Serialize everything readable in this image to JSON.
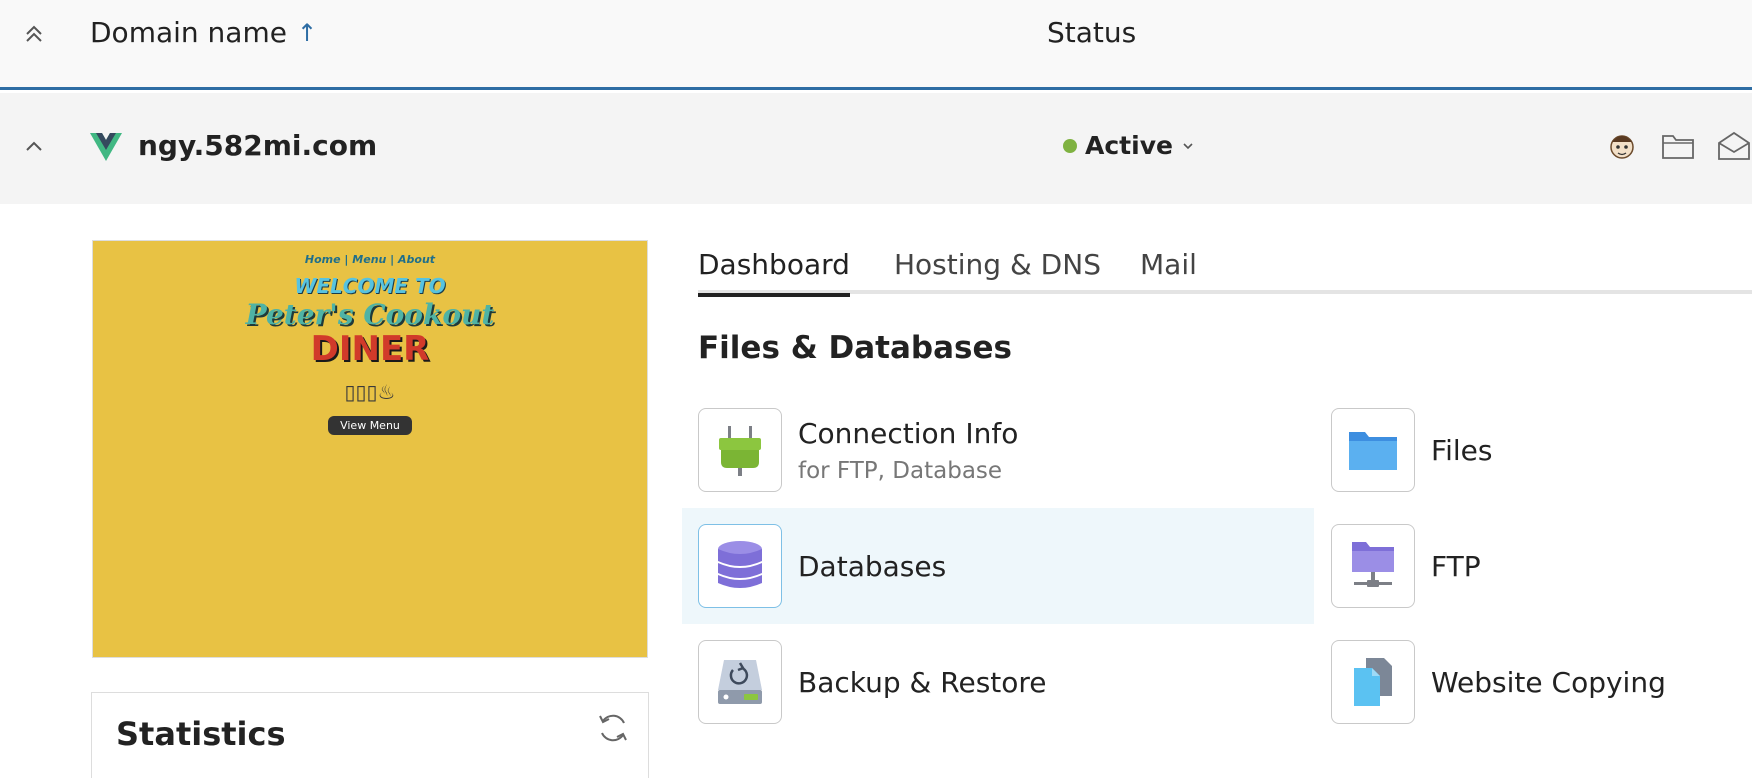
{
  "header": {
    "domain_col": "Domain name",
    "sort_arrow": "↑",
    "status_col": "Status"
  },
  "domain": {
    "name": "ngy.582mi.com",
    "status": "Active",
    "status_color": "#7fb241",
    "icons": [
      "site-avatar-icon",
      "folder-icon",
      "mail-icon"
    ]
  },
  "preview": {
    "nav": "Home | Menu | About",
    "welcome": "WELCOME TO",
    "name": "Peter's Cookout",
    "diner": "DINER",
    "icons": "▯▯▯♨",
    "button": "View Menu"
  },
  "statistics": {
    "title": "Statistics"
  },
  "tabs": [
    {
      "label": "Dashboard",
      "active": true
    },
    {
      "label": "Hosting & DNS",
      "active": false
    },
    {
      "label": "Mail",
      "active": false
    }
  ],
  "section": {
    "title": "Files & Databases"
  },
  "tools": {
    "connection": {
      "label": "Connection Info",
      "sub": "for FTP, Database"
    },
    "files": {
      "label": "Files"
    },
    "databases": {
      "label": "Databases"
    },
    "ftp": {
      "label": "FTP"
    },
    "backup": {
      "label": "Backup & Restore"
    },
    "copying": {
      "label": "Website Copying"
    }
  }
}
